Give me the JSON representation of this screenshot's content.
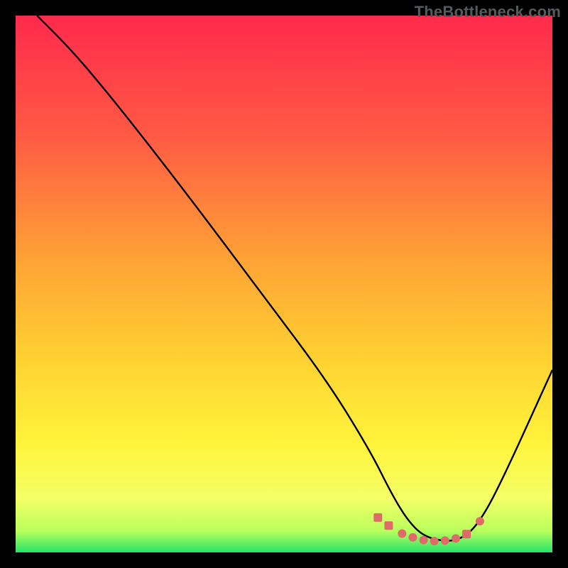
{
  "watermark": "TheBottleneck.com",
  "chart_data": {
    "type": "line",
    "title": "",
    "xlabel": "",
    "ylabel": "",
    "xlim": [
      0,
      100
    ],
    "ylim": [
      0,
      100
    ],
    "grid": false,
    "legend": false,
    "gradient_stops": [
      {
        "offset": 0,
        "color": "#ff2a4d"
      },
      {
        "offset": 22,
        "color": "#ff5944"
      },
      {
        "offset": 45,
        "color": "#ffa136"
      },
      {
        "offset": 65,
        "color": "#ffd432"
      },
      {
        "offset": 80,
        "color": "#fff43c"
      },
      {
        "offset": 90,
        "color": "#f4ff66"
      },
      {
        "offset": 96,
        "color": "#b9ff5c"
      },
      {
        "offset": 100,
        "color": "#27e36a"
      }
    ],
    "series": [
      {
        "name": "bottleneck-curve",
        "color": "#000000",
        "x": [
          4,
          10,
          16,
          24,
          34,
          46,
          58,
          66,
          70,
          73,
          76,
          80,
          83,
          86,
          90,
          100
        ],
        "y": [
          100,
          94,
          87,
          77,
          64,
          48,
          32,
          19,
          11,
          6,
          3,
          2,
          2.5,
          5,
          12,
          34
        ]
      }
    ],
    "markers": {
      "name": "data-points",
      "color": "#e06a6a",
      "shapes": [
        "square",
        "square",
        "circle",
        "circle",
        "circle",
        "circle",
        "circle",
        "circle",
        "square",
        "circle"
      ],
      "x": [
        67.5,
        69.5,
        72,
        74,
        76,
        78,
        80,
        82,
        84,
        86.5
      ],
      "y": [
        6.5,
        5.0,
        3.5,
        2.8,
        2.3,
        2.1,
        2.2,
        2.6,
        3.4,
        5.8
      ]
    }
  }
}
